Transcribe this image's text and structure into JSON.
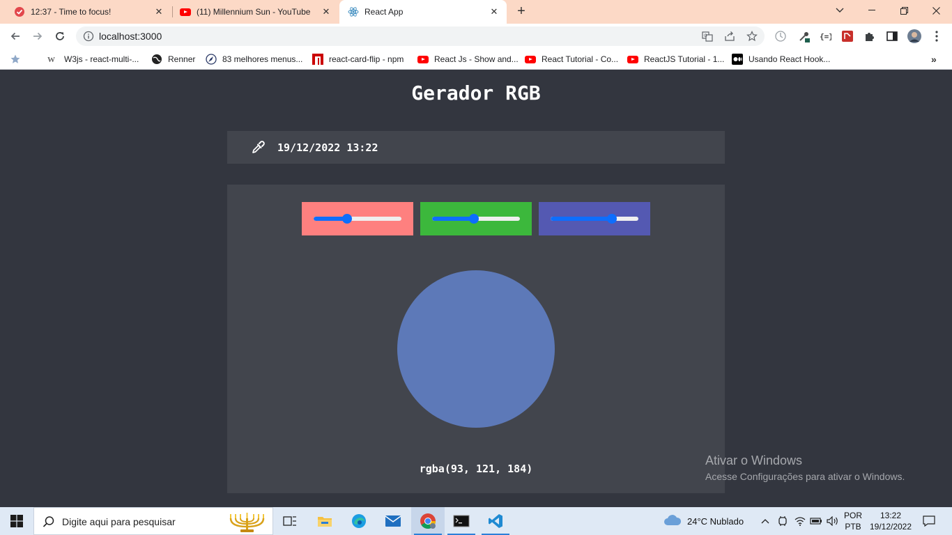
{
  "browser": {
    "tabs": [
      {
        "title": "12:37 - Time to focus!",
        "icon": "focus-timer-icon"
      },
      {
        "title": "(11) Millennium Sun - YouTube",
        "icon": "youtube-icon"
      },
      {
        "title": "React App",
        "icon": "react-icon"
      }
    ],
    "active_tab_index": 2,
    "url": "localhost:3000",
    "bookmarks": [
      {
        "label": "W3js - react-multi-...",
        "icon": "w3js-icon"
      },
      {
        "label": "Renner",
        "icon": "globe-icon"
      },
      {
        "label": "83 melhores menus...",
        "icon": "compass-icon"
      },
      {
        "label": "react-card-flip - npm",
        "icon": "npm-icon"
      },
      {
        "label": "React Js - Show and...",
        "icon": "youtube-icon"
      },
      {
        "label": "React Tutorial - Co...",
        "icon": "youtube-icon"
      },
      {
        "label": "ReactJS Tutorial - 1...",
        "icon": "youtube-icon"
      },
      {
        "label": "Usando React Hook...",
        "icon": "medium-icon"
      }
    ]
  },
  "app": {
    "title": "Gerador RGB",
    "datetime": "19/12/2022 13:22",
    "sliders": [
      {
        "channel": "red",
        "value": 93,
        "max": 255,
        "bg_color": "#fe807f"
      },
      {
        "channel": "green",
        "value": 121,
        "max": 255,
        "bg_color": "#3cb83c"
      },
      {
        "channel": "blue",
        "value": 184,
        "max": 255,
        "bg_color": "#5459b2"
      }
    ],
    "preview_color": "#5d79b8",
    "rgba_text": "rgba(93, 121, 184)"
  },
  "watermark": {
    "line1": "Ativar o Windows",
    "line2": "Acesse Configurações para ativar o Windows."
  },
  "taskbar": {
    "search_placeholder": "Digite aqui para pesquisar",
    "weather": "24°C  Nublado",
    "lang_1": "POR",
    "lang_2": "PTB",
    "time": "13:22",
    "date": "19/12/2022"
  }
}
